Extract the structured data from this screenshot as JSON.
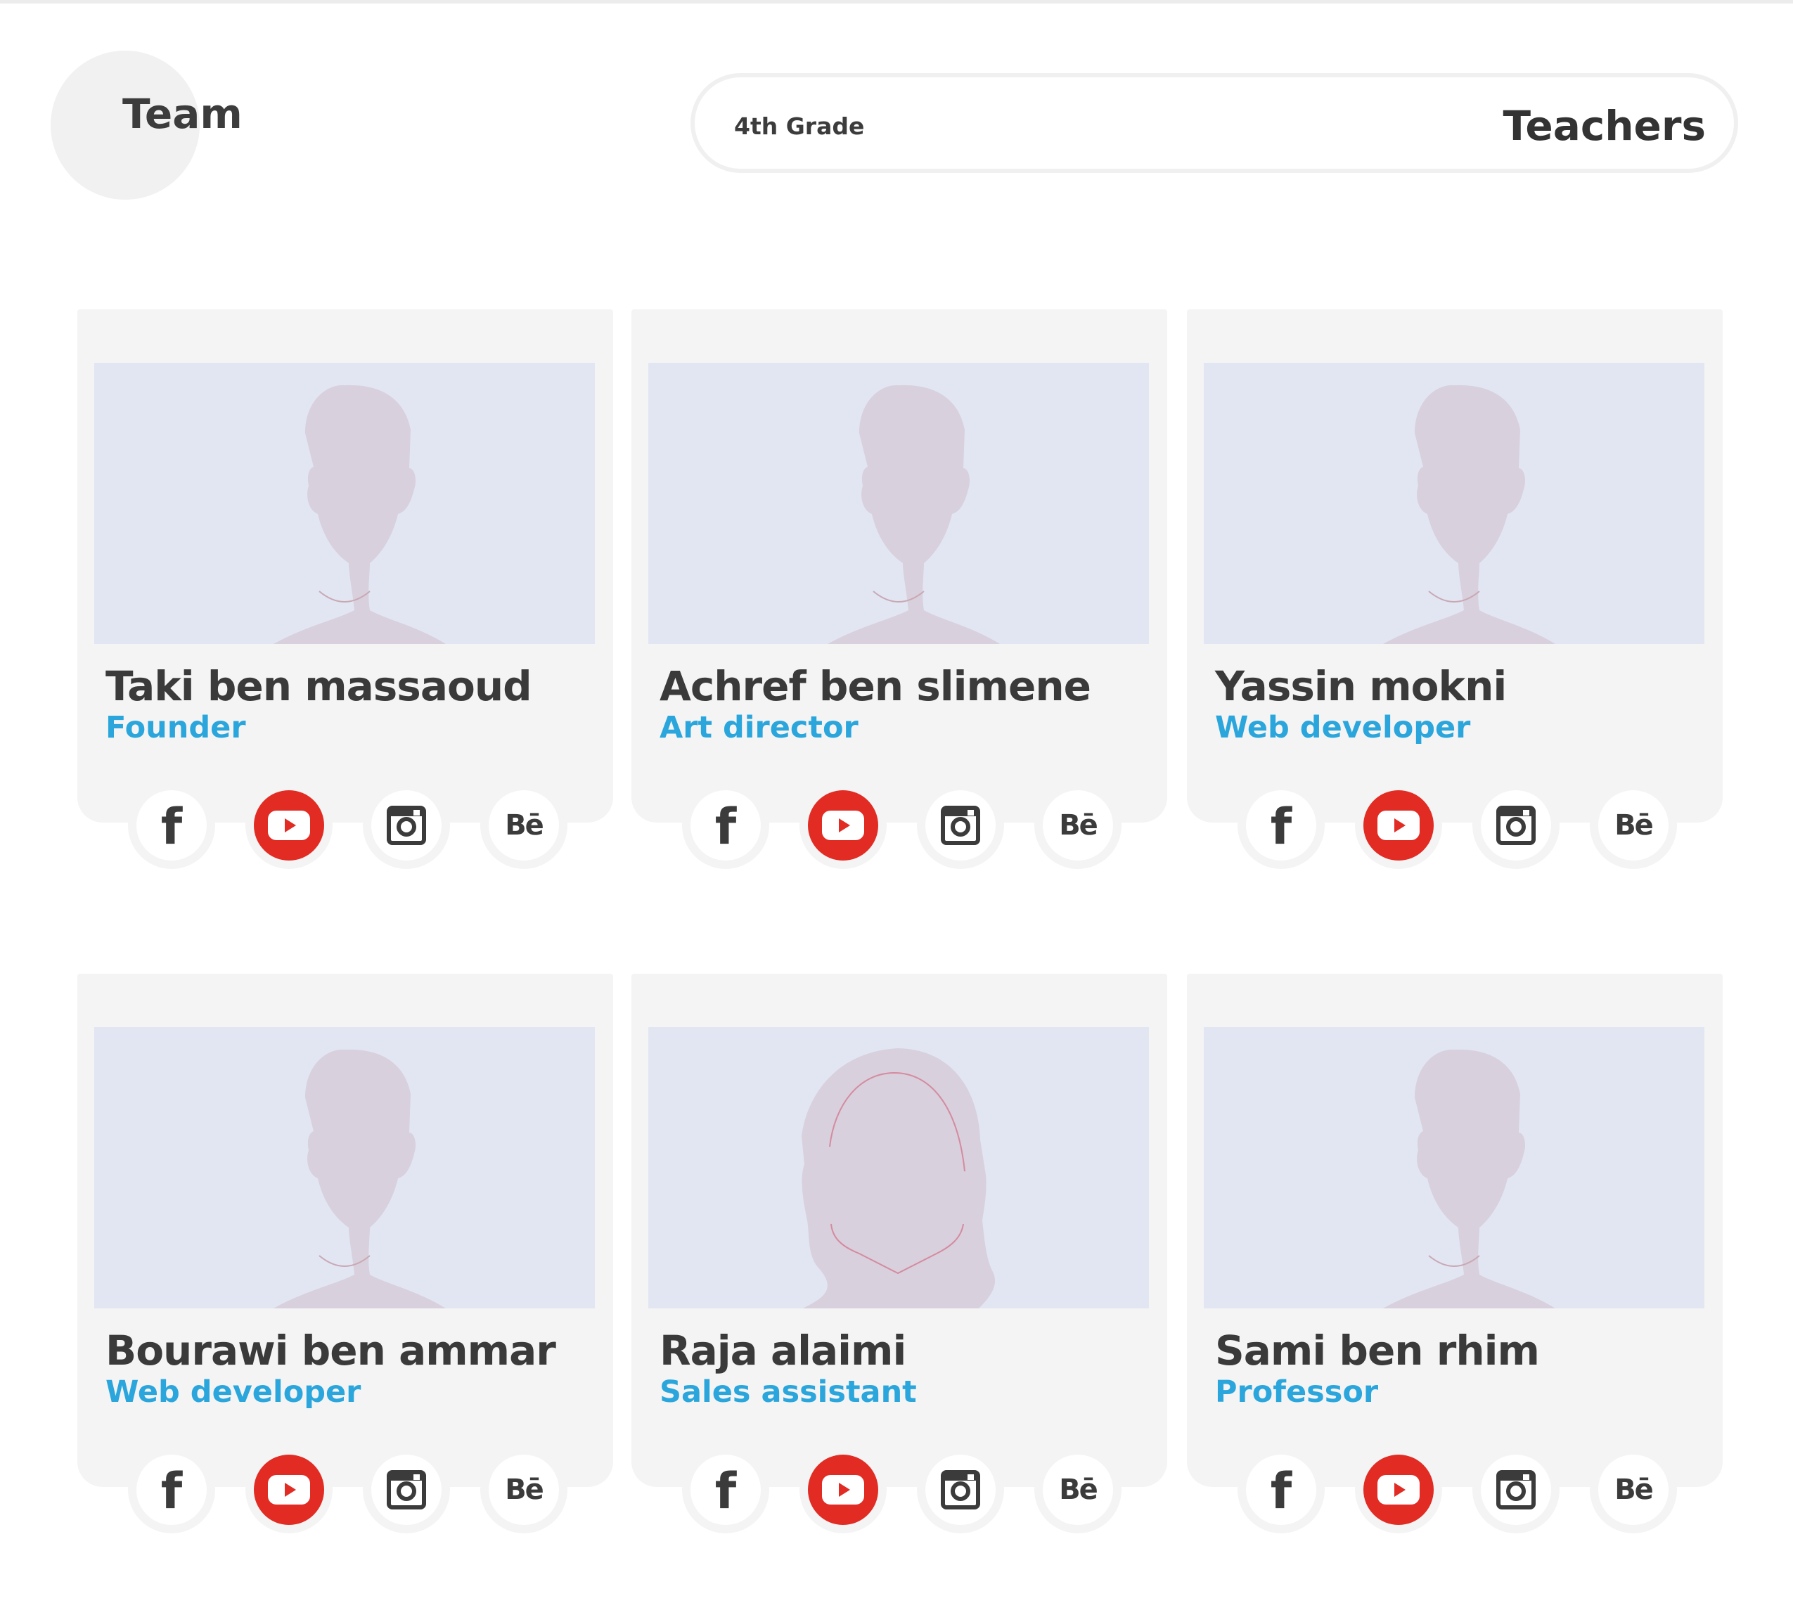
{
  "header": {
    "logo_text": "Team",
    "grade_label": "4th Grade",
    "page_title": "Teachers"
  },
  "social_icons": [
    "facebook-icon",
    "youtube-icon",
    "instagram-icon",
    "behance-icon"
  ],
  "social_labels": {
    "facebook": "f",
    "behance": "Bē"
  },
  "colors": {
    "accent": "#2ba6dc",
    "youtube": "#e12b23",
    "card_bg": "#f4f4f4",
    "photo_bg": "#e1e6f2",
    "text": "#3a3a3a"
  },
  "team": [
    {
      "name": "Taki ben massaoud",
      "role": "Founder",
      "avatar": "male-avatar"
    },
    {
      "name": "Achref ben slimene",
      "role": "Art director",
      "avatar": "male-avatar"
    },
    {
      "name": "Yassin mokni",
      "role": "Web developer",
      "avatar": "male-avatar"
    },
    {
      "name": "Bourawi ben ammar",
      "role": "Web developer",
      "avatar": "male-avatar"
    },
    {
      "name": "Raja alaimi",
      "role": "Sales assistant",
      "avatar": "female-avatar"
    },
    {
      "name": "Sami ben rhim",
      "role": "Professor",
      "avatar": "male-avatar"
    }
  ]
}
